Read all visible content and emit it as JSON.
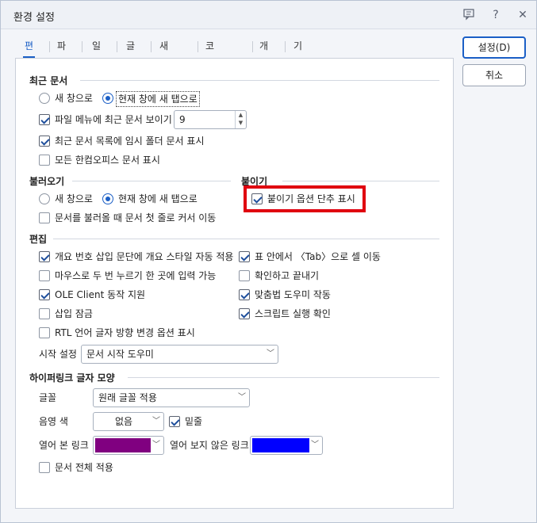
{
  "window": {
    "title": "환경 설정"
  },
  "titlebar": {
    "icons": [
      "feedback-icon",
      "help-icon",
      "close-icon"
    ],
    "help_glyph": "?",
    "close_glyph": "✕"
  },
  "tabs": [
    "편집",
    "파일",
    "일반",
    "글꼴",
    "새 문서",
    "코드 형식",
    "개체",
    "기타"
  ],
  "buttons": {
    "ok": "설정(D)",
    "cancel": "취소"
  },
  "recent": {
    "heading": "최근 문서",
    "radio_new": "새 창으로",
    "radio_tab": "현재 창에 새 탭으로",
    "show_recent_label": "파일 메뉴에 최근 문서 보이기",
    "show_recent_count": "9",
    "temp_folder_label": "최근 문서 목록에 임시 폴더 문서 표시",
    "all_hancom_label": "모든 한컴오피스 문서 표시"
  },
  "open": {
    "heading": "불러오기",
    "radio_new": "새 창으로",
    "radio_tab": "현재 창에 새 탭으로",
    "cursor_label": "문서를 불러올 때 문서 첫 줄로 커서 이동"
  },
  "paste": {
    "heading": "붙이기",
    "shortcut_label": "붙이기 옵션 단추 표시"
  },
  "edit": {
    "heading": "편집",
    "left": [
      {
        "label": "개요 번호 삽입 문단에 개요 스타일 자동 적용",
        "checked": true
      },
      {
        "label": "마우스로 두 번 누르기 한 곳에 입력 가능",
        "checked": false
      },
      {
        "label": "OLE Client 동작 지원",
        "checked": true
      },
      {
        "label": "삽입 잠금",
        "checked": false
      },
      {
        "label": "RTL 언어 글자 방향 변경 옵션 표시",
        "checked": false
      }
    ],
    "right": [
      {
        "label": "표 안에서 〈Tab〉으로 셀 이동",
        "checked": true
      },
      {
        "label": "확인하고 끝내기",
        "checked": false
      },
      {
        "label": "맞춤법 도우미 작동",
        "checked": true
      },
      {
        "label": "스크립트 실행 확인",
        "checked": true
      }
    ],
    "start_label": "시작 설정",
    "start_value": "문서 시작 도우미"
  },
  "hyperlink": {
    "heading": "하이퍼링크 글자 모양",
    "font_label": "글꼴",
    "font_value": "원래 글꼴 적용",
    "shade_label": "음영 색",
    "shade_value": "없음",
    "underline_label": "밑줄",
    "visited_label": "열어 본 링크",
    "visited_color": "#800080",
    "unvisited_label": "열어 보지 않은 링크",
    "unvisited_color": "#0000ff",
    "apply_all_label": "문서 전체 적용"
  },
  "colors": {
    "accent": "#1b5fc6",
    "highlight": "#e0000f"
  }
}
